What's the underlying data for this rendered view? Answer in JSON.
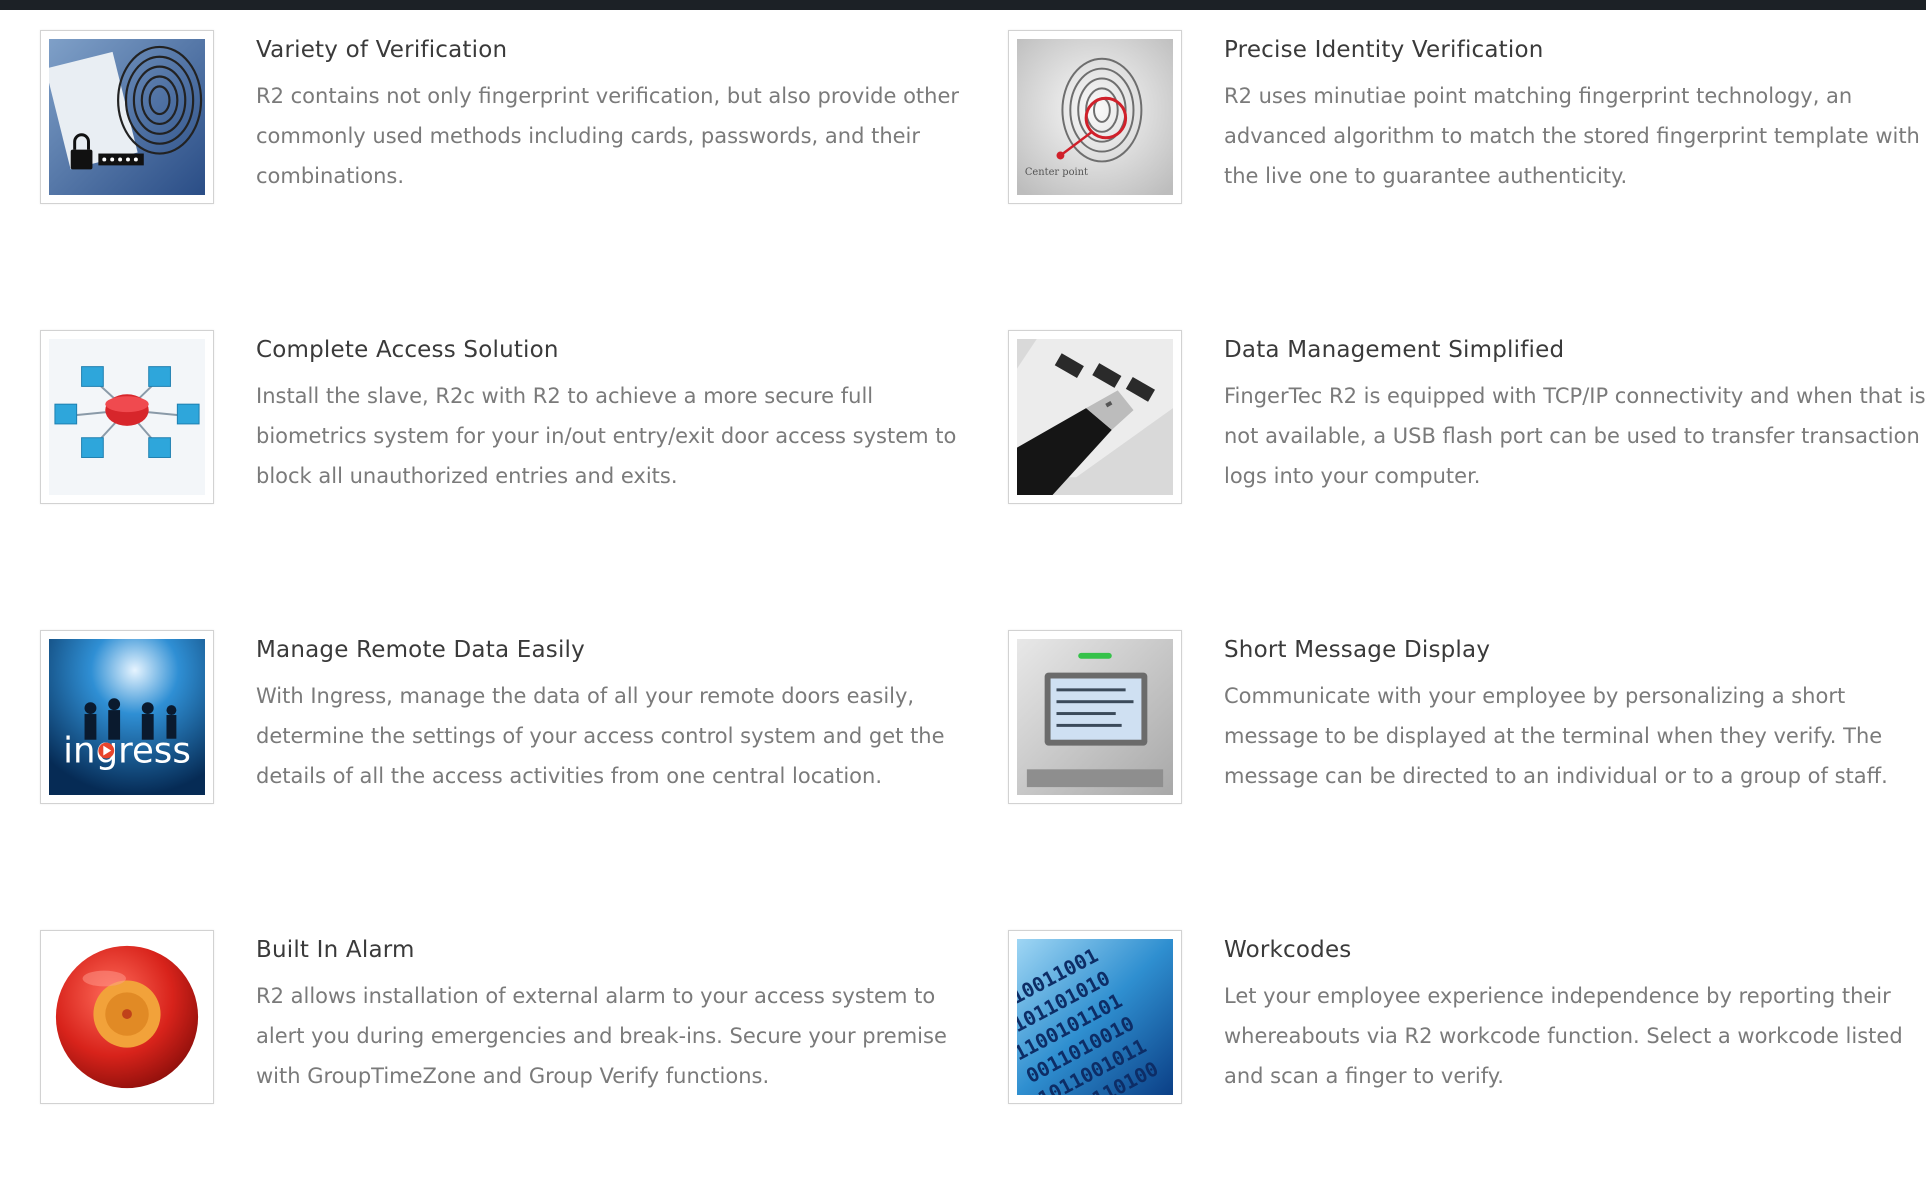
{
  "features": [
    {
      "title": "Variety of Verification",
      "description": "R2 contains not only fingerprint verification, but also provide other commonly used methods including cards, passwords, and their combinations."
    },
    {
      "title": "Precise Identity Verification",
      "description": "R2 uses minutiae point matching fingerprint technology, an advanced algorithm to match the stored fingerprint template with the live one to guarantee authenticity.",
      "image_caption": "Center point"
    },
    {
      "title": "Complete Access Solution",
      "description": "Install the slave, R2c with R2 to achieve a more secure full biometrics system for your in/out entry/exit door access system to block all unauthorized entries and exits."
    },
    {
      "title": "Data Management Simplified",
      "description": "FingerTec R2 is equipped with TCP/IP connectivity and when that is not available, a USB flash port can be used to transfer transaction logs into your computer."
    },
    {
      "title": "Manage Remote Data Easily",
      "description": "With Ingress, manage the data of all your remote doors easily, determine the settings of your access control system and get the details of all the access activities from one central location.",
      "image_caption": "ingress"
    },
    {
      "title": "Short Message Display",
      "description": "Communicate with your employee by personalizing a short message to be displayed at the terminal when they verify. The message can be directed to an individual or to a group of staff."
    },
    {
      "title": "Built In Alarm",
      "description": "R2 allows installation of external alarm to your access system to alert you during emergencies and break-ins. Secure your premise with GroupTimeZone and Group Verify functions."
    },
    {
      "title": "Workcodes",
      "description": "Let your employee experience independence by reporting their whereabouts via R2 workcode function. Select a workcode listed and scan a finger to verify."
    }
  ],
  "icons": [
    "fingerprint-card-icon",
    "fingerprint-center-point-icon",
    "network-nodes-icon",
    "usb-flash-drive-icon",
    "ingress-logo-icon",
    "terminal-display-icon",
    "alarm-bell-icon",
    "binary-code-icon"
  ]
}
